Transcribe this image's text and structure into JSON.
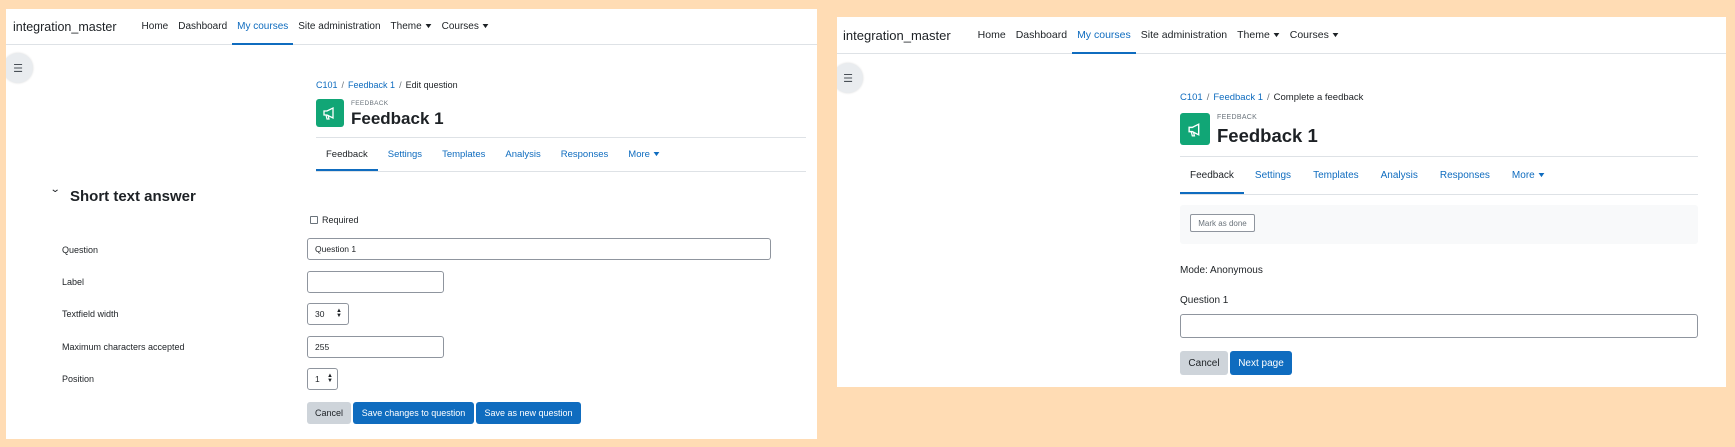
{
  "left": {
    "brand": "integration_master",
    "nav": [
      "Home",
      "Dashboard",
      "My courses",
      "Site administration",
      "Theme",
      "Courses"
    ],
    "breadcrumb": {
      "course": "C101",
      "activity": "Feedback 1",
      "current": "Edit question"
    },
    "kicker": "FEEDBACK",
    "title": "Feedback 1",
    "tabs": [
      "Feedback",
      "Settings",
      "Templates",
      "Analysis",
      "Responses",
      "More"
    ],
    "section_title": "Short text answer",
    "required_label": "Required",
    "question_label": "Question",
    "question_value": "Question 1",
    "label_label": "Label",
    "label_value": "",
    "width_label": "Textfield width",
    "width_value": "30",
    "maxchars_label": "Maximum characters accepted",
    "maxchars_value": "255",
    "position_label": "Position",
    "position_value": "1",
    "cancel": "Cancel",
    "save_changes": "Save changes to question",
    "save_new": "Save as new question"
  },
  "right": {
    "brand": "integration_master",
    "nav": [
      "Home",
      "Dashboard",
      "My courses",
      "Site administration",
      "Theme",
      "Courses"
    ],
    "breadcrumb": {
      "course": "C101",
      "activity": "Feedback 1",
      "current": "Complete a feedback"
    },
    "kicker": "FEEDBACK",
    "title": "Feedback 1",
    "tabs": [
      "Feedback",
      "Settings",
      "Templates",
      "Analysis",
      "Responses",
      "More"
    ],
    "mark_done": "Mark as done",
    "mode": "Mode: Anonymous",
    "question_label": "Question 1",
    "answer_value": "",
    "cancel": "Cancel",
    "next": "Next page"
  },
  "colors": {
    "background": "#ffdcb4",
    "link": "#0f6cbf",
    "feedback_icon": "#11a676",
    "primary_button": "#0f6cbf",
    "secondary_button": "#ced4da"
  },
  "icons": [
    "course-index-icon",
    "megaphone-icon",
    "chevron-down-icon",
    "chevron-section-icon",
    "select-arrows-icon"
  ]
}
